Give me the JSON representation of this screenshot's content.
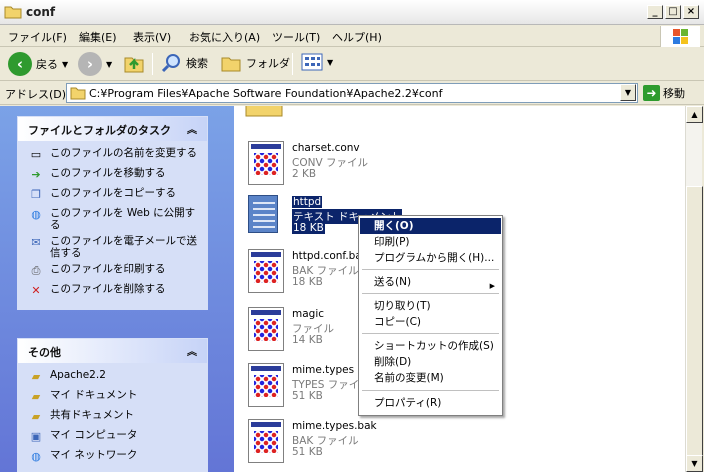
{
  "window": {
    "title": "conf"
  },
  "menu": [
    "ファイル(F)",
    "編集(E)",
    "表示(V)",
    "お気に入り(A)",
    "ツール(T)",
    "ヘルプ(H)"
  ],
  "toolbar": {
    "back": "戻る",
    "search": "検索",
    "folders": "フォルダ"
  },
  "address": {
    "label": "アドレス(D)",
    "path": "C:¥Program Files¥Apache Software Foundation¥Apache2.2¥conf",
    "go": "移動"
  },
  "tasks": {
    "header": "ファイルとフォルダのタスク",
    "items": [
      "このファイルの名前を変更する",
      "このファイルを移動する",
      "このファイルをコピーする",
      "このファイルを Web に公開する",
      "このファイルを電子メールで送信する",
      "このファイルを印刷する",
      "このファイルを削除する"
    ]
  },
  "other": {
    "header": "その他",
    "items": [
      "Apache2.2",
      "マイ ドキュメント",
      "共有ドキュメント",
      "マイ コンピュータ",
      "マイ ネットワーク"
    ]
  },
  "files": [
    {
      "name": "charset.conv",
      "type": "CONV ファイル",
      "size": "2 KB"
    },
    {
      "name": "httpd",
      "type": "テキスト ドキュメント",
      "size": "18 KB"
    },
    {
      "name": "httpd.conf.bak",
      "type": "BAK ファイル",
      "size": "18 KB"
    },
    {
      "name": "magic",
      "type": "ファイル",
      "size": "14 KB"
    },
    {
      "name": "mime.types",
      "type": "TYPES ファイル",
      "size": "51 KB"
    },
    {
      "name": "mime.types.bak",
      "type": "BAK ファイル",
      "size": "51 KB"
    }
  ],
  "context_menu": [
    "開く(O)",
    "印刷(P)",
    "プログラムから開く(H)...",
    "送る(N)",
    "切り取り(T)",
    "コピー(C)",
    "ショートカットの作成(S)",
    "削除(D)",
    "名前の変更(M)",
    "プロパティ(R)"
  ],
  "colors": {
    "selection": "#0b246a",
    "taskpane": "#6375d6"
  }
}
